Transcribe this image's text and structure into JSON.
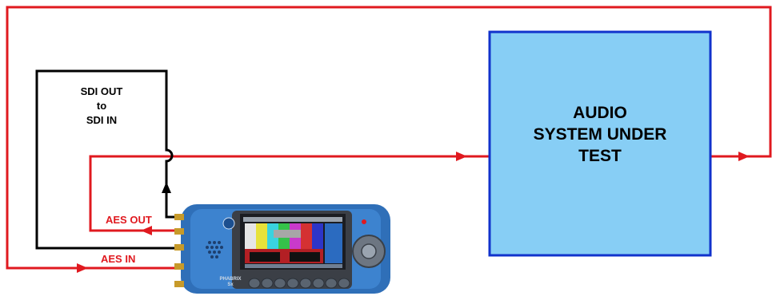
{
  "labels": {
    "sdi_line1": "SDI OUT",
    "sdi_line2": "to",
    "sdi_line3": "SDI IN",
    "aes_out": "AES OUT",
    "aes_in": "AES IN",
    "sut_line1": "AUDIO",
    "sut_line2": "SYSTEM UNDER",
    "sut_line3": "TEST"
  },
  "device": {
    "brand_line1": "PHABRIX",
    "brand_line2": "Sx"
  },
  "colors": {
    "signal_red": "#e0191f",
    "sdi_black": "#000000",
    "box_fill": "#87cef5",
    "box_border": "#1133cc",
    "device_blue": "#2f6fb8"
  },
  "icons": [
    "arrow-right-icon",
    "arrow-left-icon",
    "arrow-up-icon",
    "speaker-grille-icon",
    "dpad-icon"
  ]
}
